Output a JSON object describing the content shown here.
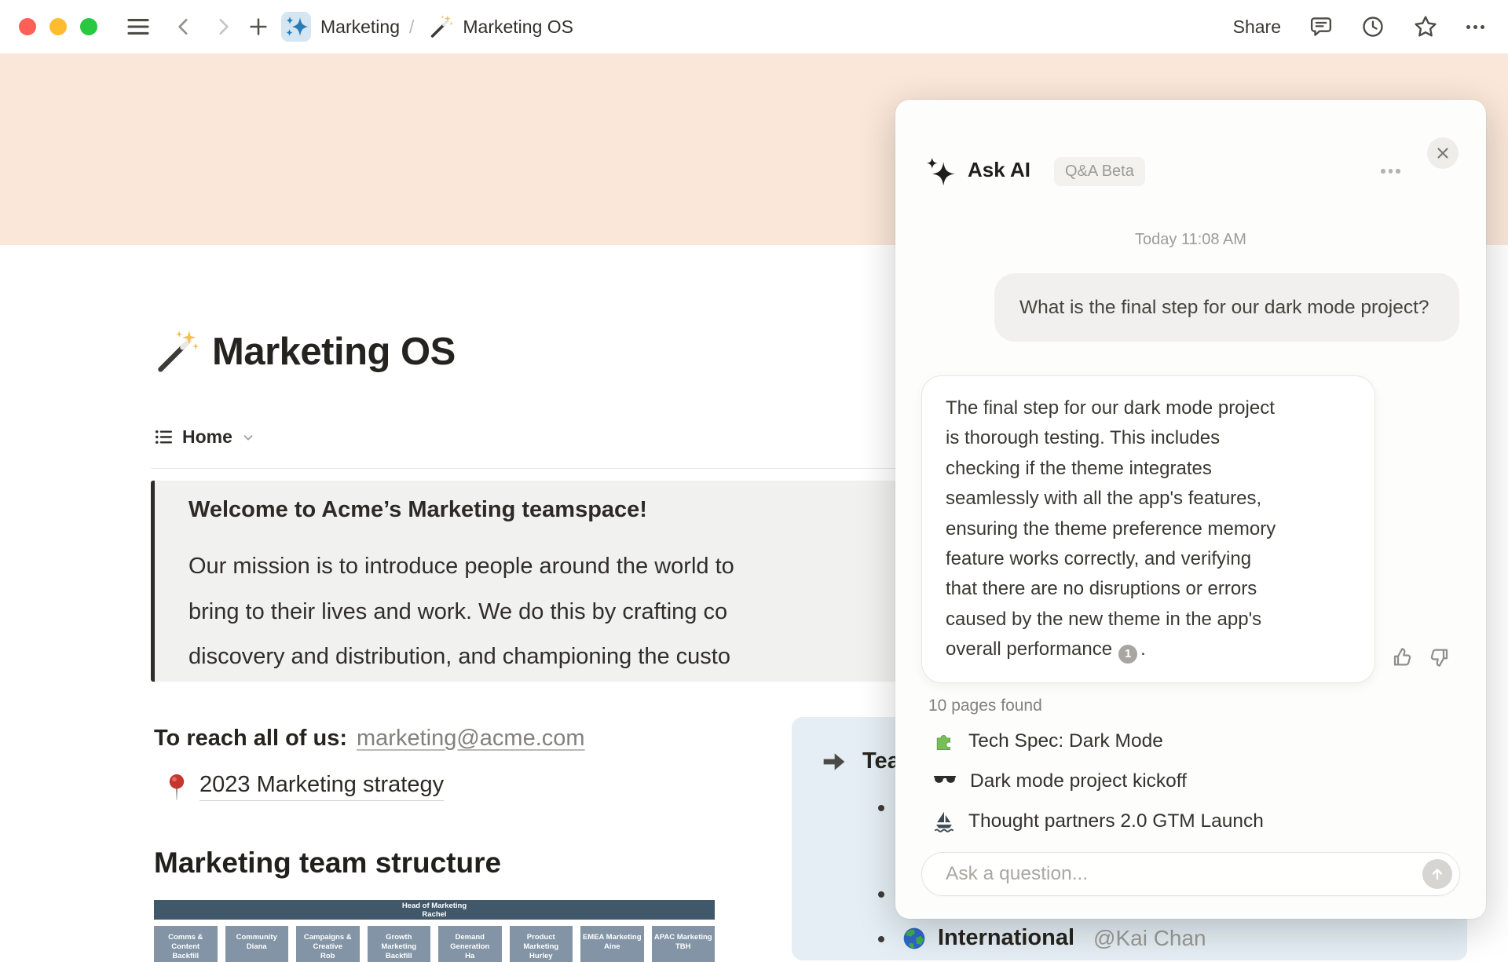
{
  "chrome": {
    "breadcrumb_teamspace": "Marketing",
    "breadcrumb_separator": "/",
    "breadcrumb_page": "Marketing OS",
    "share_label": "Share"
  },
  "page": {
    "title": "Marketing OS",
    "view_tab": "Home",
    "callout_heading": "Welcome to Acme’s Marketing teamspace!",
    "callout_lines": [
      "Our mission is to introduce people around the world to",
      "bring to their lives and work. We do this by crafting co",
      "discovery and distribution, and championing the custo"
    ],
    "reach_label": "To reach all of us:",
    "reach_email": "marketing@acme.com",
    "strategy_link": "2023 Marketing strategy",
    "team_heading": "Marketing team structure",
    "org": {
      "head_title": "Head of Marketing",
      "head_name": "Rachel",
      "boxes": [
        {
          "title": "Comms & Content",
          "name": "Backfill"
        },
        {
          "title": "Community",
          "name": "Diana"
        },
        {
          "title": "Campaigns & Creative",
          "name": "Rob"
        },
        {
          "title": "Growth Marketing",
          "name": "Backfill"
        },
        {
          "title": "Demand Generation",
          "name": "Ha"
        },
        {
          "title": "Product Marketing",
          "name": "Hurley"
        },
        {
          "title": "EMEA Marketing",
          "name": "Aine"
        },
        {
          "title": "APAC Marketing",
          "name": "TBH"
        }
      ]
    },
    "team_card_heading_visible": "Tea",
    "intl_label": "International",
    "intl_mention": "@Kai Chan"
  },
  "ai": {
    "title": "Ask AI",
    "badge": "Q&A Beta",
    "timestamp": "Today 11:08 AM",
    "question": "What is the final step for our dark mode project?",
    "answer_lines": [
      "The final step for our dark mode project",
      "is thorough testing. This includes",
      "checking if the theme integrates",
      "seamlessly with all the app's features,",
      "ensuring the theme preference memory",
      "feature works correctly, and verifying",
      "that there are no disruptions or errors",
      "caused by the new theme in the app's",
      "overall performance"
    ],
    "citation": "1",
    "answer_suffix": ".",
    "pages_found": "10 pages found",
    "results": [
      {
        "icon": "puzzle-piece",
        "title": "Tech Spec: Dark Mode"
      },
      {
        "icon": "sunglasses",
        "title": "Dark mode project kickoff"
      },
      {
        "icon": "sailboat",
        "title": "Thought partners 2.0 GTM Launch"
      }
    ],
    "input_placeholder": "Ask a question..."
  },
  "colors": {
    "cover_banner": "#fae7d9",
    "teamspace_icon_bg": "#d4e6f1",
    "teamspace_icon_sparkle": "#2a7ab8",
    "callout_bg": "#f1f1ef",
    "team_card_bg": "#e4eef4",
    "org_head_bar": "#41586a",
    "org_box": "#8294a6",
    "traffic_red": "#ff5f57",
    "traffic_yellow": "#febc2e",
    "traffic_green": "#28c840"
  }
}
